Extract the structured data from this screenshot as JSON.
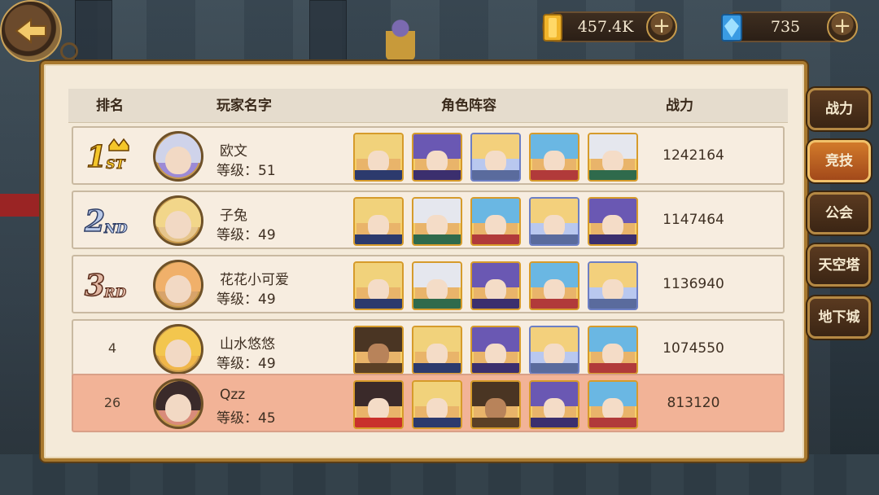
{
  "top_bar": {
    "gold": {
      "value": "457.4K",
      "icon": "gold-bar-icon"
    },
    "gems": {
      "value": "735",
      "icon": "blue-gem-icon"
    },
    "plus_label": "+"
  },
  "table": {
    "headers": [
      "排名",
      "玩家名字",
      "角色阵容",
      "战力"
    ],
    "rows": [
      {
        "rank": "1",
        "rank_badge": "1st",
        "name": "欧文",
        "level": "等级：51",
        "power": "1242164",
        "highlight": false
      },
      {
        "rank": "2",
        "rank_badge": "2nd",
        "name": "子兔",
        "level": "等级：49",
        "power": "1147464",
        "highlight": false
      },
      {
        "rank": "3",
        "rank_badge": "3rd",
        "name": "花花小可爱",
        "level": "等级：49",
        "power": "1136940",
        "highlight": false
      },
      {
        "rank": "4",
        "rank_badge": "",
        "name": "山水悠悠",
        "level": "等级：49",
        "power": "1074550",
        "highlight": false
      },
      {
        "rank": "26",
        "rank_badge": "",
        "name": "Qzz",
        "level": "等级：45",
        "power": "813120",
        "highlight": true
      }
    ]
  },
  "tabs": [
    {
      "label": "战力",
      "active": false
    },
    {
      "label": "竞技",
      "active": true
    },
    {
      "label": "公会",
      "active": false
    },
    {
      "label": "天空塔",
      "active": false
    },
    {
      "label": "地下城",
      "active": false
    }
  ],
  "colors": {
    "panel_bg": "#f4ead9",
    "highlight_row": "#f2b397",
    "active_tab": "#d27a2a"
  }
}
